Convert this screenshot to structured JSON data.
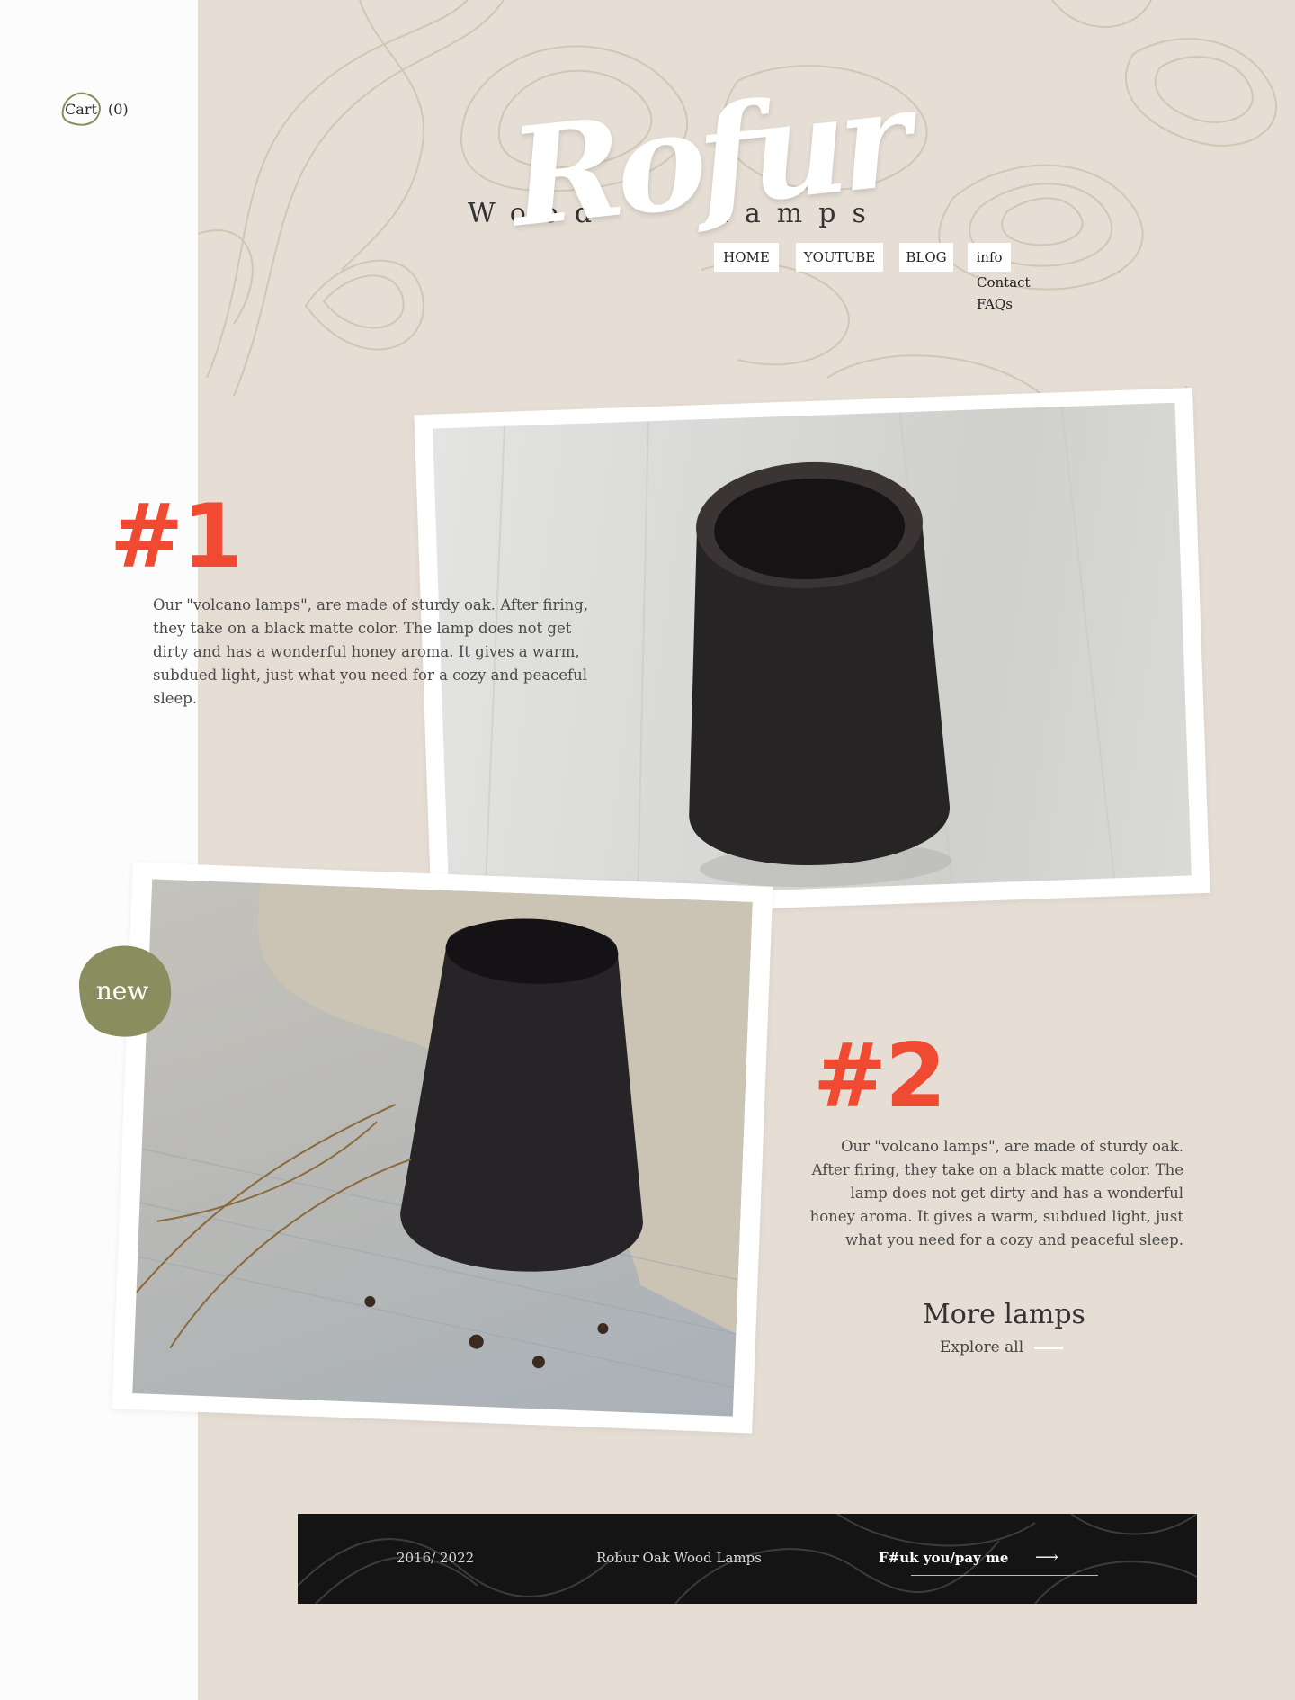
{
  "cart": {
    "label": "Cart",
    "count": "(0)"
  },
  "brand": {
    "script": "Rofur",
    "left": "Wood",
    "right": "Lamps"
  },
  "nav": {
    "items": [
      "HOME",
      "YOUTUBE",
      "BLOG",
      "info"
    ],
    "submenu": [
      "Contact",
      "FAQs"
    ]
  },
  "products": [
    {
      "number": "#1",
      "description": "Our \"volcano lamps\", are made of sturdy oak. After firing, they take on a black matte color. The lamp does not get dirty and has a wonderful honey aroma. It gives a warm, subdued light, just what you need for a cozy and peaceful sleep."
    },
    {
      "number": "#2",
      "badge": "new",
      "description": "Our \"volcano lamps\", are made of sturdy oak. After firing, they take on a black matte color. The lamp does not get dirty and has a wonderful honey aroma. It gives a warm, subdued light, just what you need for a cozy and peaceful sleep."
    }
  ],
  "more": {
    "title": "More lamps",
    "link": "Explore all"
  },
  "footer": {
    "years": "2016/ 2022",
    "brand": "Robur Oak Wood Lamps",
    "cta": "F#uk you/pay me",
    "arrow": "⟶"
  },
  "colors": {
    "accent": "#f04a33",
    "olive": "#8a8d5e",
    "beige": "#e6ddd4",
    "footer": "#141414"
  }
}
